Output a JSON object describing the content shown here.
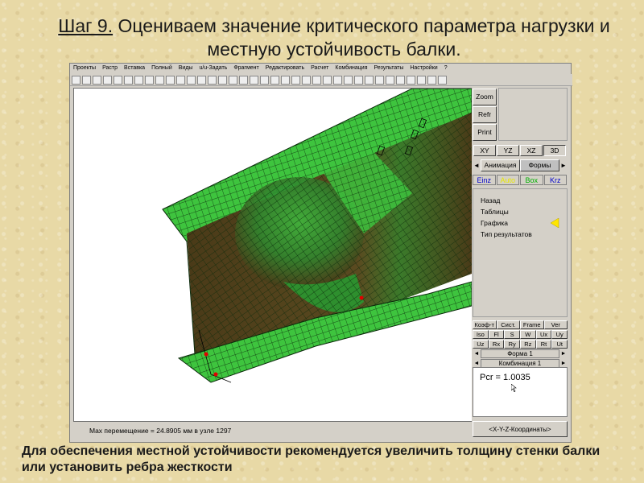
{
  "slide": {
    "title_step": "Шаг 9.",
    "title_rest": " Оцениваем значение критического параметра нагрузки и местную устойчивость балки.",
    "note": "Для обеспечения местной устойчивости рекомендуется увеличить толщину стенки балки или установить ребра жесткости"
  },
  "menubar": [
    "Проекты",
    "Растр",
    "Вставка",
    "Полный",
    "Виды",
    "u/u-Задать",
    "Фрагмент",
    "Редактировать",
    "Расчет",
    "Комбинация",
    "Результаты",
    "Настройки",
    "?"
  ],
  "statusbar": {
    "text": "Max перемещение  = 24.8905 мм в узле 1297"
  },
  "panel": {
    "zoom": "Zoom",
    "refr": "Refr",
    "print": "Print",
    "views": [
      "XY",
      "YZ",
      "XZ",
      "3D"
    ],
    "tab_left_arrow": "◄",
    "tab_right_arrow": "►",
    "tabs": [
      "Анимация",
      "Формы"
    ],
    "chips": [
      {
        "label": "Einz",
        "color": "#0000cc"
      },
      {
        "label": "Auto",
        "color": "#e8e800"
      },
      {
        "label": "Box",
        "color": "#00b000"
      },
      {
        "label": "Krz",
        "color": "#0000cc"
      }
    ],
    "menu_items": [
      "Назад",
      "Таблицы",
      "Графика",
      "Тип результатов"
    ],
    "small_tabs": [
      "Коэф-т",
      "Сист.",
      "Frame",
      "Ver"
    ],
    "comp_row1": [
      "Iso",
      "Fl",
      "S",
      "W",
      "Ux",
      "Uy"
    ],
    "comp_row2": [
      "Uz",
      "Rx",
      "Ry",
      "Rz",
      "Rt",
      "Ut"
    ],
    "shape_selector": "Форма  1",
    "combo_selector": "Комбинация 1",
    "result": "Pcr = 1.0035",
    "coords": "<X-Y-Z-Координаты>"
  },
  "colors": {
    "mesh_light": "#3ec43e",
    "mesh_dark": "#4a3a18",
    "highlight": "#ffe600"
  }
}
